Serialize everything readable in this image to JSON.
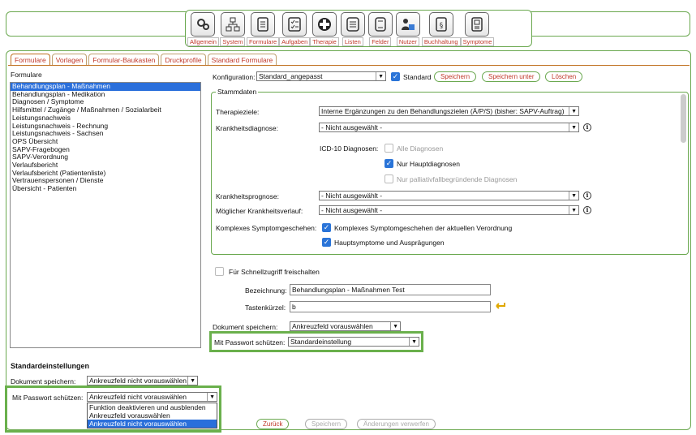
{
  "toolbar": {
    "items": [
      {
        "icon": "gears-icon",
        "label": "Allgemein"
      },
      {
        "icon": "network-icon",
        "label": "System"
      },
      {
        "icon": "forms-icon",
        "label": "Formulare"
      },
      {
        "icon": "tasks-icon",
        "label": "Aufgaben"
      },
      {
        "icon": "medical-cross-icon",
        "label": "Therapie"
      },
      {
        "icon": "lists-icon",
        "label": "Listen"
      },
      {
        "icon": "fields-icon",
        "label": "Felder"
      },
      {
        "icon": "users-icon",
        "label": "Nutzer"
      },
      {
        "icon": "accounting-icon",
        "label": "Buchhaltung"
      },
      {
        "icon": "symptoms-icon",
        "label": "Symptome"
      }
    ]
  },
  "tabs": [
    "Formulare",
    "Vorlagen",
    "Formular-Baukasten",
    "Druckprofile",
    "Standard Formulare"
  ],
  "left": {
    "heading": "Formulare",
    "items": [
      "Behandlungsplan - Maßnahmen",
      "Behandlungsplan - Medikation",
      "Diagnosen / Symptome",
      "Hilfsmittel / Zugänge / Maßnahmen / Sozialarbeit",
      "Leistungsnachweis",
      "Leistungsnachweis - Rechnung",
      "Leistungsnachweis - Sachsen",
      "OPS Übersicht",
      "SAPV-Fragebogen",
      "SAPV-Verordnung",
      "Verlaufsbericht",
      "Verlaufsbericht (Patientenliste)",
      "Vertrauenspersonen / Dienste",
      "Übersicht - Patienten"
    ],
    "std_heading": "Standardeinstellungen",
    "doc_label": "Dokument speichern:",
    "doc_value": "Ankreuzfeld nicht vorauswählen",
    "pw_label": "Mit Passwort schützen:",
    "pw_value": "Ankreuzfeld nicht vorauswählen",
    "pw_options": [
      "Funktion deaktivieren und ausblenden",
      "Ankreuzfeld vorauswählen",
      "Ankreuzfeld nicht vorauswählen"
    ]
  },
  "config": {
    "label": "Konfiguration:",
    "value": "Standard_angepasst",
    "standard_label": "Standard",
    "save": "Speichern",
    "save_as": "Speichern unter",
    "delete": "Löschen"
  },
  "stamm": {
    "legend": "Stammdaten",
    "therapieziele_label": "Therapieziele:",
    "therapieziele_value": "Interne Ergänzungen zu den Behandlungszielen (Ä/P/S) (bisher: SAPV-Auftrag)",
    "krankheitsdiagnose_label": "Krankheitsdiagnose:",
    "not_selected": "- Nicht ausgewählt -",
    "icd_label": "ICD-10 Diagnosen:",
    "icd_all": "Alle Diagnosen",
    "icd_main": "Nur Hauptdiagnosen",
    "icd_pall": "Nur palliativfallbegründende Diagnosen",
    "prognose_label": "Krankheitsprognose:",
    "verlauf_label": "Möglicher Krankheitsverlauf:",
    "komplex_label": "Komplexes Symptomgeschehen:",
    "komplex_opt1": "Komplexes Symptomgeschehen der aktuellen Verordnung",
    "komplex_opt2": "Hauptsymptome und Ausprägungen"
  },
  "detail": {
    "quick_label": "Für Schnellzugriff freischalten",
    "bez_label": "Bezeichnung:",
    "bez_value": "Behandlungsplan - Maßnahmen Test",
    "key_label": "Tastenkürzel:",
    "key_value": "b",
    "doc_label": "Dokument speichern:",
    "doc_value": "Ankreuzfeld vorauswählen",
    "pw_label": "Mit Passwort schützen:",
    "pw_value": "Standardeinstellung"
  },
  "footer": {
    "back": "Zurück",
    "save": "Speichern",
    "discard": "Änderungen verwerfen"
  }
}
